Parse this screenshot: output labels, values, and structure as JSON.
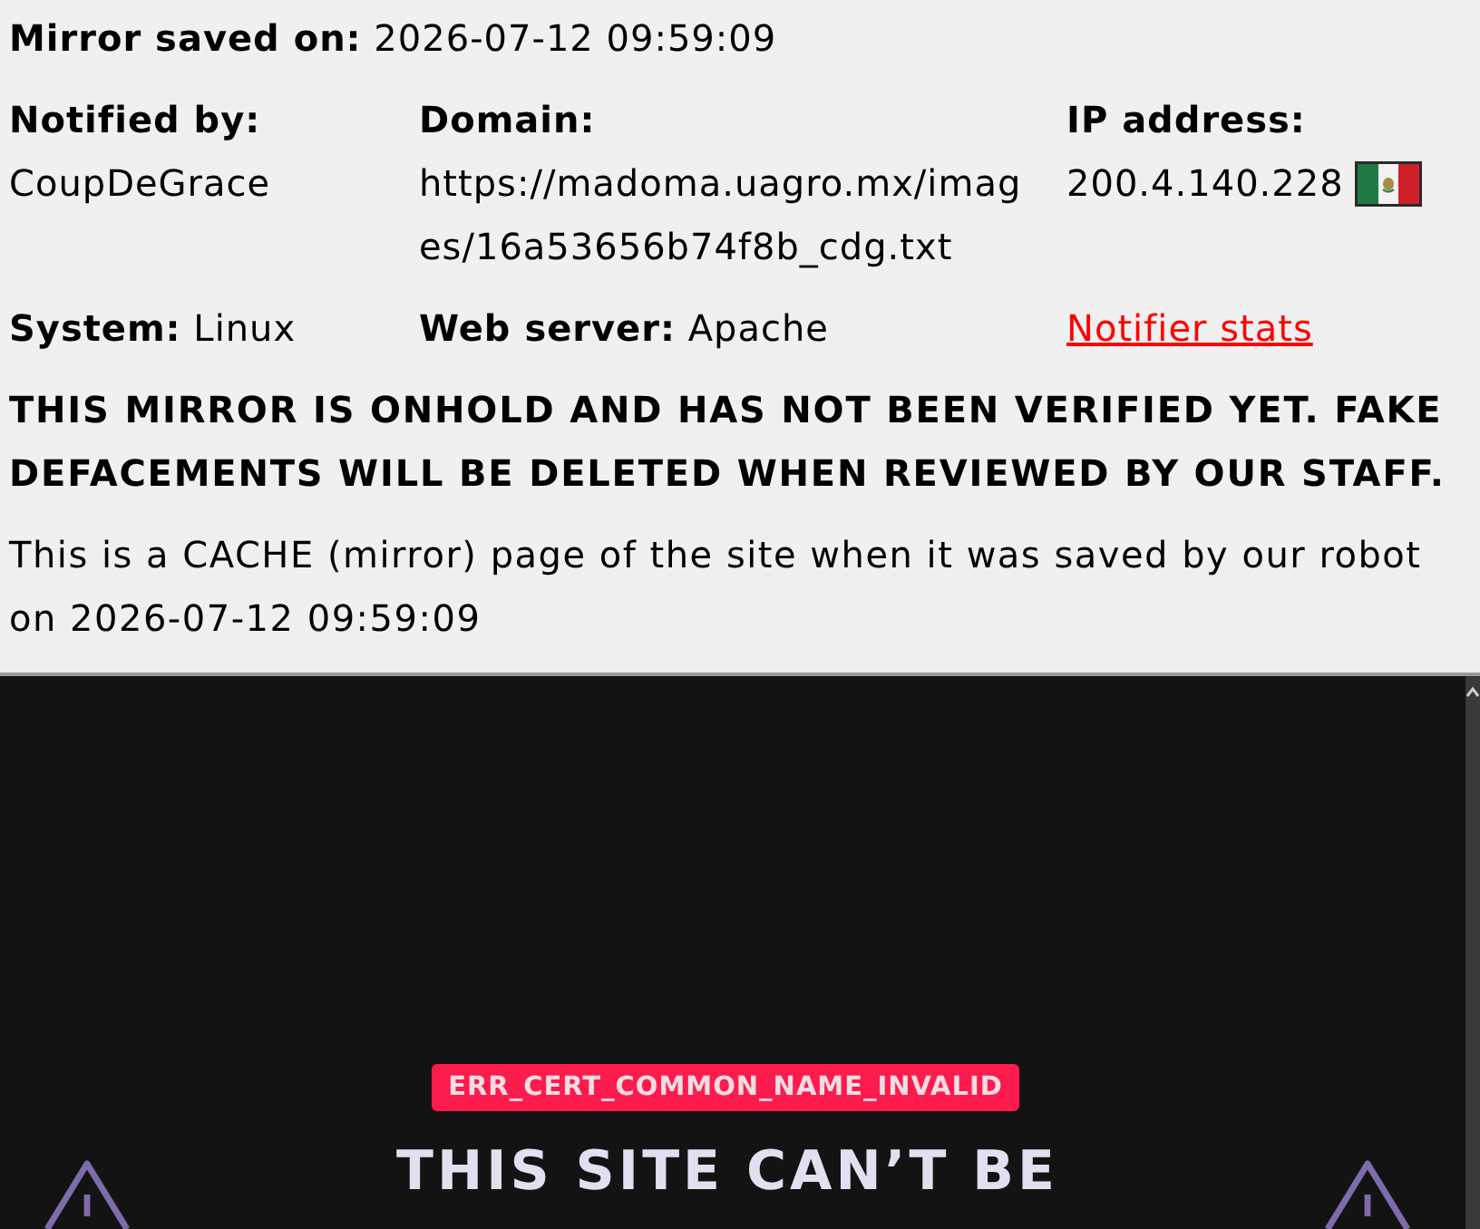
{
  "mirror_saved": {
    "label": "Mirror saved on:",
    "value": "2026-07-12 09:59:09"
  },
  "details": [
    {
      "kind": "plain",
      "label": "Notified by:",
      "value": "CoupDeGrace"
    },
    {
      "kind": "wrapped",
      "label": "Domain:",
      "value": "https://madoma.uagro.mx/images/16a53656b74f8b_cdg.txt"
    },
    {
      "kind": "flagged",
      "label": "IP address:",
      "value": "200.4.140.228"
    }
  ],
  "meta": [
    {
      "label": "System:",
      "value": "Linux"
    },
    {
      "label": "Web server:",
      "value": "Apache"
    }
  ],
  "notifier_stats_link": "Notifier stats",
  "notice": "THIS MIRROR IS ONHOLD AND HAS NOT BEEN VERIFIED YET. FAKE DEFACEMENTS WILL BE DELETED WHEN REVIEWED BY OUR STAFF.",
  "cache_note": "This is a CACHE (mirror) page of the site when it was saved by our robot on 2026-07-12 09:59:09",
  "cached_page": {
    "error_code": "ERR_CERT_COMMON_NAME_INVALID",
    "heading": "THIS SITE CAN’T BE"
  }
}
